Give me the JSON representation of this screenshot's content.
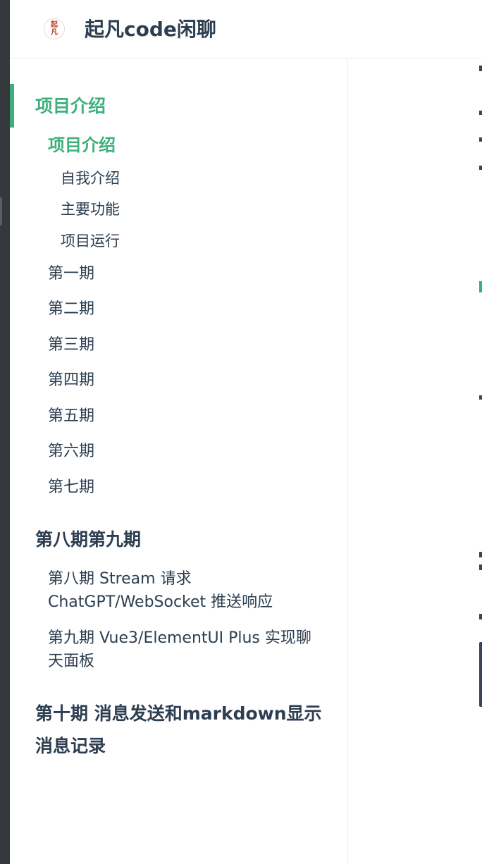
{
  "site": {
    "title": "起凡code闲聊",
    "logo_text_line1": "起",
    "logo_text_line2": "凡"
  },
  "colors": {
    "accent": "#3eaf7c",
    "text": "#2c3e50",
    "border": "#eaecef",
    "left_strip": "#35383d"
  },
  "sidebar": {
    "groups": [
      {
        "heading": "项目介绍",
        "active": true,
        "children": [
          {
            "label": "项目介绍",
            "active": true,
            "sub": [
              "自我介绍",
              "主要功能",
              "项目运行"
            ]
          },
          {
            "label": "第一期"
          },
          {
            "label": "第二期"
          },
          {
            "label": "第三期"
          },
          {
            "label": "第四期"
          },
          {
            "label": "第五期"
          },
          {
            "label": "第六期"
          },
          {
            "label": "第七期"
          }
        ]
      },
      {
        "heading": "第八期第九期",
        "children": [
          {
            "label_line1": "第八期 Stream 请求",
            "label_line2": "ChatGPT/WebSocket 推送响应"
          },
          {
            "label_line1": "第九期 Vue3/ElementUI Plus 实现聊",
            "label_line2": "天面板"
          }
        ]
      },
      {
        "heading_line1": "第十期 消息发送和markdown显示",
        "heading_line2": "消息记录"
      }
    ]
  }
}
